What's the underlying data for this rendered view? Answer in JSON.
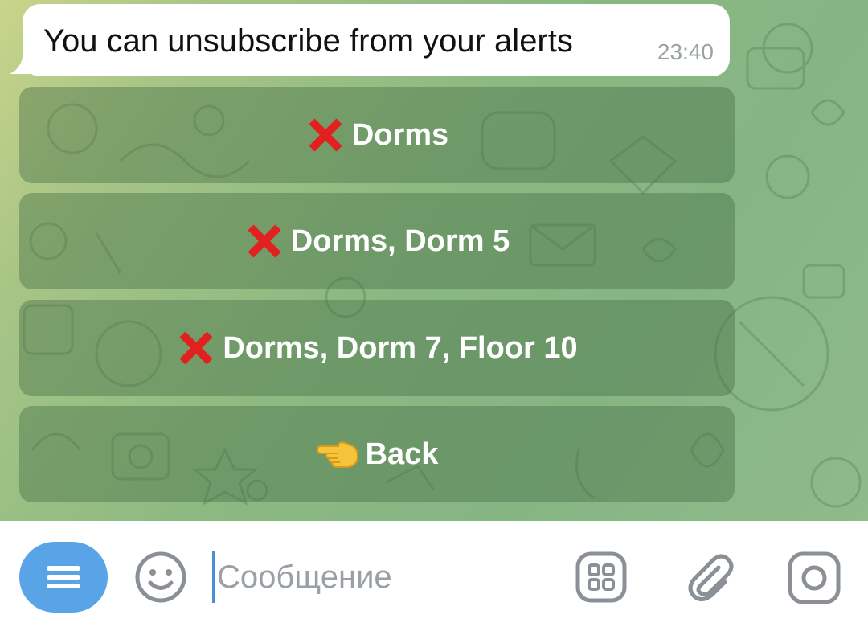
{
  "message": {
    "text": "You can unsubscribe from your alerts",
    "time": "23:40"
  },
  "keyboard": {
    "buttons": [
      {
        "icon": "cross-mark-icon",
        "label": "Dorms"
      },
      {
        "icon": "cross-mark-icon",
        "label": "Dorms, Dorm 5"
      },
      {
        "icon": "cross-mark-icon",
        "label": "Dorms, Dorm 7, Floor 10"
      },
      {
        "icon": "pointing-left-hand-icon",
        "label": "Back"
      }
    ]
  },
  "input_bar": {
    "placeholder": "Сообщение",
    "value": "",
    "icons": [
      "menu-icon",
      "emoji-icon",
      "apps-icon",
      "paperclip-icon",
      "camera-icon"
    ]
  },
  "colors": {
    "accent": "#58a4e6",
    "button_bg": "#5f8f5f",
    "cross": "#e0211f",
    "wallpaper": "#8cb982"
  }
}
